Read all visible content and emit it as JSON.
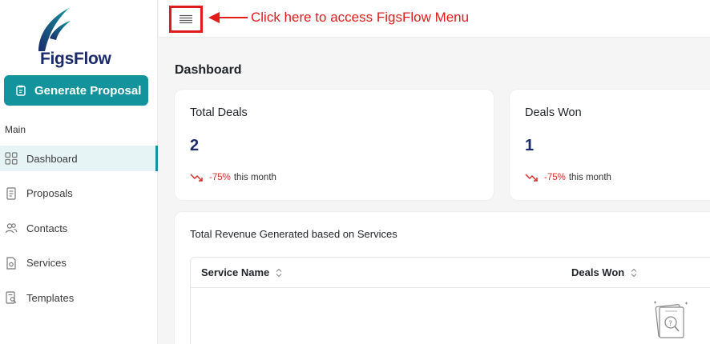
{
  "app": {
    "brand": "FigsFlow",
    "accent_color": "#13949c",
    "brand_color": "#1b2a6b",
    "annotation_color": "#e11b1b"
  },
  "sidebar": {
    "generate_button_label": "Generate Proposal",
    "section_label": "Main",
    "items": [
      {
        "label": "Dashboard",
        "icon": "grid-icon",
        "active": true
      },
      {
        "label": "Proposals",
        "icon": "document-icon",
        "active": false
      },
      {
        "label": "Contacts",
        "icon": "users-icon",
        "active": false
      },
      {
        "label": "Services",
        "icon": "service-doc-icon",
        "active": false
      },
      {
        "label": "Templates",
        "icon": "template-search-icon",
        "active": false
      }
    ]
  },
  "header": {
    "menu_icon": "hamburger-menu-icon",
    "annotation_text": "Click here to access FigsFlow Menu"
  },
  "main": {
    "page_title": "Dashboard",
    "cards": [
      {
        "title": "Total Deals",
        "value": "2",
        "change": "-75%",
        "period": "this month"
      },
      {
        "title": "Deals Won",
        "value": "1",
        "change": "-75%",
        "period": "this month"
      }
    ],
    "revenue": {
      "title": "Total Revenue Generated based on Services",
      "columns": [
        "Service Name",
        "Deals Won"
      ]
    }
  }
}
